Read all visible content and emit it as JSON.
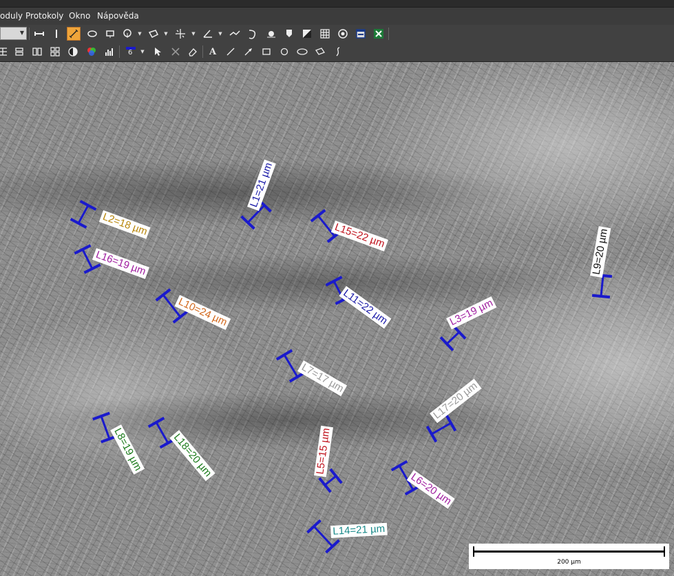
{
  "menu": [
    "oduly",
    "Protokoly",
    "Okno",
    "Nápověda"
  ],
  "toolbar_top": [
    "line-style-icon",
    "vertical-line-icon",
    "measure-line-icon",
    "ellipse-icon",
    "rectangle-icon",
    "circle-measure-icon",
    "polygon-icon",
    "cross-points-icon",
    "angle-icon",
    "polyline-icon",
    "curve-icon",
    "drop-icon",
    "marker-icon",
    "threshold-icon",
    "grid-icon",
    "target-icon",
    "window-icon",
    "excel-icon"
  ],
  "toolbar_bottom": [
    "align-left-icon",
    "align-center-icon",
    "columns-icon",
    "gallery-icon",
    "contrast-icon",
    "color-channels-icon",
    "histogram-icon",
    "line-width-icon",
    "pointer-icon",
    "delete-icon",
    "eraser-icon",
    "text-tool-icon",
    "line-tool-icon",
    "arrow-tool-icon",
    "rectangle-tool-icon",
    "circle-tool-icon",
    "ellipse-tool-icon",
    "polygon-tool-icon",
    "freehand-tool-icon"
  ],
  "line_width_value": "6",
  "annotation_color": "#1a1acc",
  "measurements": [
    {
      "label": "L1=21 µm",
      "color": "#1a1aa8"
    },
    {
      "label": "L2=18 µm",
      "color": "#b8860b"
    },
    {
      "label": "L15=22 µm",
      "color": "#c0141e"
    },
    {
      "label": "L9=20 µm",
      "color": "#111111"
    },
    {
      "label": "L16=19 µm",
      "color": "#a020a0"
    },
    {
      "label": "L11=22 µm",
      "color": "#1a1aa8"
    },
    {
      "label": "L10=24 µm",
      "color": "#d2691e"
    },
    {
      "label": "L3=19 µm",
      "color": "#a020a0"
    },
    {
      "label": "L7=17 µm",
      "color": "#9a9a9a"
    },
    {
      "label": "L17=20 µm",
      "color": "#9a9a9a"
    },
    {
      "label": "L8=19 µm",
      "color": "#1a7a1a"
    },
    {
      "label": "L18=20 µm",
      "color": "#1a7a1a"
    },
    {
      "label": "L5=15 µm",
      "color": "#c0141e"
    },
    {
      "label": "L6=20 µm",
      "color": "#a020a0"
    },
    {
      "label": "L14=21 µm",
      "color": "#1a8a8a"
    }
  ],
  "scale_bar": {
    "label": "200 µm"
  }
}
